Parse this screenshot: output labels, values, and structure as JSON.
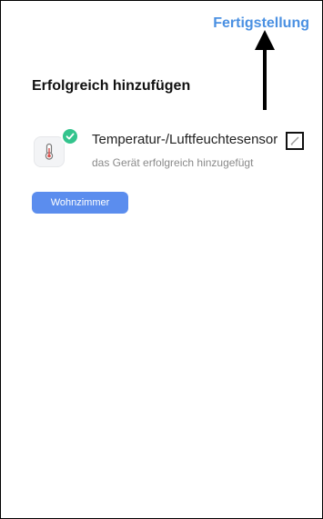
{
  "header": {
    "done_label": "Fertigstellung"
  },
  "main": {
    "title": "Erfolgreich hinzufügen",
    "device": {
      "name": "Temperatur-/Luftfeuchtesensor",
      "status": "das Gerät erfolgreich hinzugefügt",
      "icon": "thermometer-icon",
      "badge_icon": "check-icon",
      "edit_icon": "pencil-icon"
    },
    "room": {
      "label": "Wohnzimmer"
    }
  },
  "annotation": {
    "arrow_icon": "arrow-up-icon"
  },
  "colors": {
    "accent": "#4a90e2",
    "chip": "#5b8dee",
    "success": "#33c48d"
  }
}
